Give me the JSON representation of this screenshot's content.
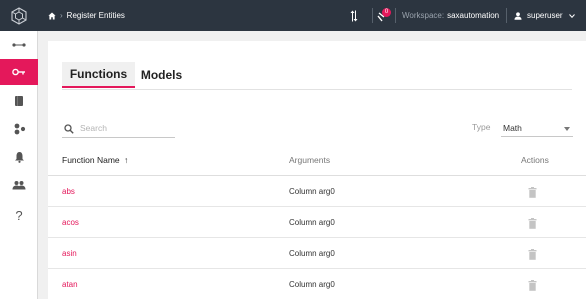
{
  "topbar": {
    "breadcrumb_current": "Register Entities",
    "breadcrumb_separator": "›",
    "notification_count": "0",
    "workspace_label": "Workspace:",
    "workspace_name": "saxautomation",
    "user_name": "superuser"
  },
  "sidebar": {
    "items": [
      {
        "icon": "nodes-icon",
        "active": false
      },
      {
        "icon": "key-icon",
        "active": true
      },
      {
        "icon": "book-icon",
        "active": false
      },
      {
        "icon": "cluster-icon",
        "active": false
      },
      {
        "icon": "bell-icon",
        "active": false
      },
      {
        "icon": "users-icon",
        "active": false
      },
      {
        "icon": "help-icon",
        "active": false,
        "text": "?"
      }
    ]
  },
  "tabs": [
    {
      "label": "Functions",
      "active": true
    },
    {
      "label": "Models",
      "active": false
    }
  ],
  "search": {
    "placeholder": "Search"
  },
  "type_filter": {
    "label": "Type",
    "value": "Math"
  },
  "table": {
    "columns": [
      "Function Name",
      "Arguments",
      "Actions"
    ],
    "sort_indicator": "↑",
    "rows": [
      {
        "name": "abs",
        "args": "Column arg0"
      },
      {
        "name": "acos",
        "args": "Column arg0"
      },
      {
        "name": "asin",
        "args": "Column arg0"
      },
      {
        "name": "atan",
        "args": "Column arg0"
      }
    ]
  },
  "colors": {
    "accent": "#e4185b",
    "topbar": "#2c3540",
    "background": "#f0f0f0"
  }
}
